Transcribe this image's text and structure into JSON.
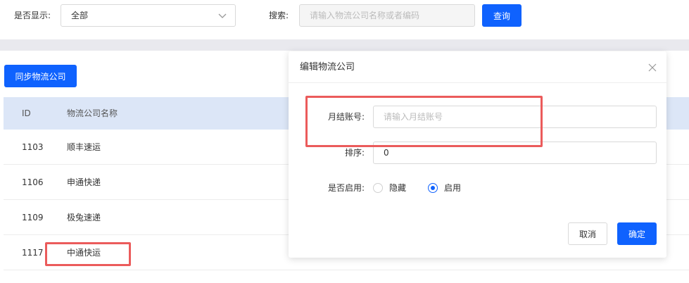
{
  "filter": {
    "display_label": "是否显示:",
    "display_value": "全部",
    "search_label": "搜索:",
    "search_placeholder": "请输入物流公司名称或者编码",
    "search_button": "查询"
  },
  "toolbar": {
    "sync_button": "同步物流公司"
  },
  "table": {
    "headers": [
      "ID",
      "物流公司名称"
    ],
    "rows": [
      {
        "id": "1103",
        "name": "顺丰速运"
      },
      {
        "id": "1106",
        "name": "申通快递"
      },
      {
        "id": "1109",
        "name": "极兔速递"
      },
      {
        "id": "1117",
        "name": "中通快运"
      }
    ]
  },
  "modal": {
    "title": "编辑物流公司",
    "account_label": "月结账号:",
    "account_placeholder": "请输入月结账号",
    "sort_label": "排序:",
    "sort_value": "0",
    "enable_label": "是否启用:",
    "radio_options": [
      "隐藏",
      "启用"
    ],
    "selected_option": "启用",
    "cancel_button": "取消",
    "confirm_button": "确定"
  },
  "colors": {
    "primary": "#0f62fe",
    "highlight": "#eb5b5b",
    "table_header_bg": "#dce6f7"
  }
}
